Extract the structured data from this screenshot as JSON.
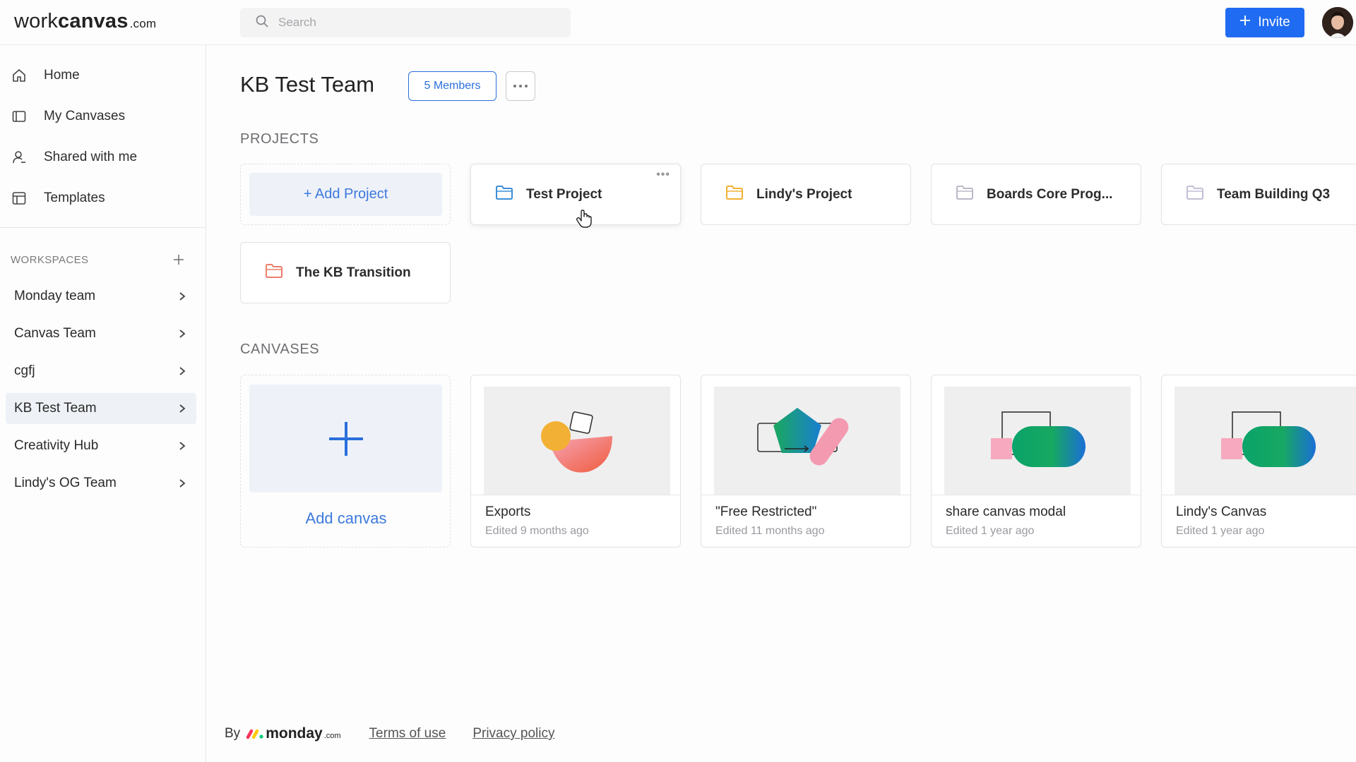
{
  "header": {
    "logo_prefix": "work",
    "logo_main": "canvas",
    "logo_suffix": ".com",
    "search_placeholder": "Search",
    "invite_label": "Invite"
  },
  "sidebar": {
    "nav": [
      {
        "label": "Home",
        "icon": "home-icon"
      },
      {
        "label": "My Canvases",
        "icon": "canvas-icon"
      },
      {
        "label": "Shared with me",
        "icon": "person-icon"
      },
      {
        "label": "Templates",
        "icon": "template-icon"
      }
    ],
    "workspaces_title": "WORKSPACES",
    "workspaces": [
      {
        "label": "Monday team",
        "active": false
      },
      {
        "label": "Canvas Team",
        "active": false
      },
      {
        "label": "cgfj",
        "active": false
      },
      {
        "label": "KB Test Team",
        "active": true
      },
      {
        "label": "Creativity Hub",
        "active": false
      },
      {
        "label": "Lindy's OG Team",
        "active": false
      }
    ]
  },
  "main": {
    "team_title": "KB Test Team",
    "members_label": "5 Members",
    "projects_title": "PROJECTS",
    "add_project_label": "+ Add Project",
    "projects": [
      {
        "label": "Test Project",
        "folder_color": "#3d8fd8"
      },
      {
        "label": "Lindy's Project",
        "folder_color": "#f2b134"
      },
      {
        "label": "Boards Core Prog...",
        "folder_color": "#b9b9c8"
      },
      {
        "label": "Team Building Q3",
        "folder_color": "#c2bfd6"
      },
      {
        "label": "The KB Transition",
        "folder_color": "#ee7e6a"
      }
    ],
    "canvases_title": "CANVASES",
    "add_canvas_label": "Add canvas",
    "canvases": [
      {
        "name": "Exports",
        "edited": "Edited 9 months ago"
      },
      {
        "name": "\"Free Restricted\"",
        "edited": "Edited 11 months ago"
      },
      {
        "name": "share canvas modal",
        "edited": "Edited 1 year ago"
      },
      {
        "name": "Lindy's Canvas",
        "edited": "Edited 1 year ago"
      }
    ]
  },
  "footer": {
    "by": "By",
    "brand": "monday",
    "brand_suffix": ".com",
    "terms": "Terms of use",
    "privacy": "Privacy policy"
  },
  "colors": {
    "accent": "#1f6bf2",
    "link_blue": "#3d79dd",
    "active_bg": "#eef1f6"
  }
}
